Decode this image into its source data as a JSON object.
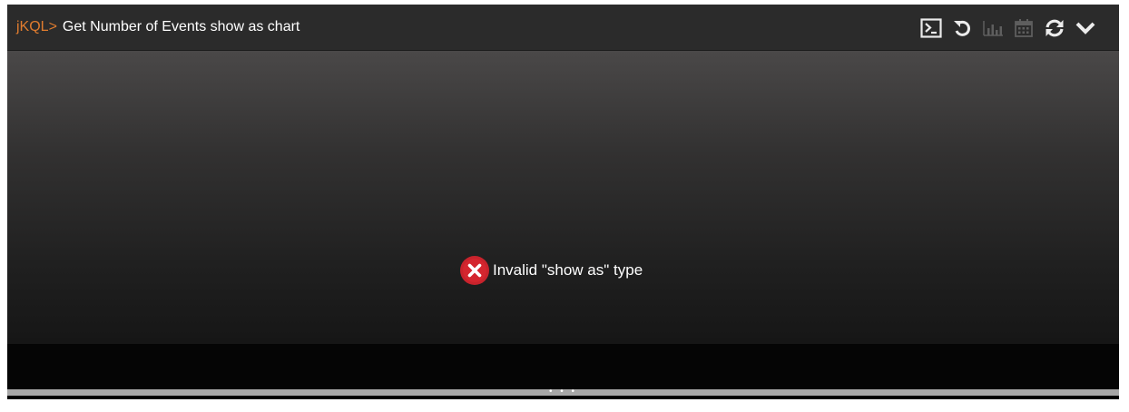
{
  "header": {
    "prefix": "jKQL>",
    "title": "Get Number of Events show as chart"
  },
  "toolbar": {
    "buttons": [
      {
        "icon": "terminal-icon",
        "enabled": true
      },
      {
        "icon": "undo-icon",
        "enabled": true
      },
      {
        "icon": "bar-chart-icon",
        "enabled": false
      },
      {
        "icon": "calendar-icon",
        "enabled": false
      },
      {
        "icon": "refresh-icon",
        "enabled": true
      },
      {
        "icon": "chevron-down-icon",
        "enabled": true
      }
    ]
  },
  "main": {
    "error_message": "Invalid \"show as\" type",
    "error_icon": "error-x-icon"
  },
  "resize_handle": {
    "glyph": "• • •"
  },
  "colors": {
    "prefix": "#e07c2e",
    "error": "#c8232c",
    "header_bg": "#2b2b2b"
  }
}
